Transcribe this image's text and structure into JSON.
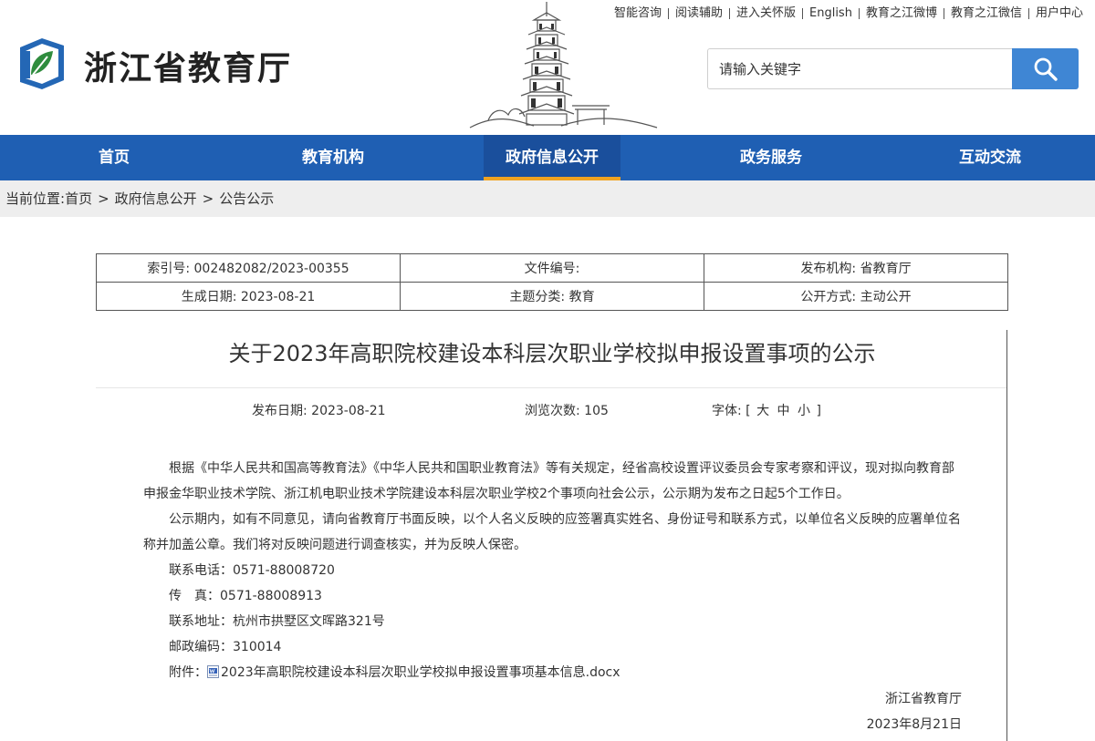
{
  "header": {
    "site_name": "浙江省教育厅",
    "top_links": [
      "智能咨询",
      "阅读辅助",
      "进入关怀版",
      "English",
      "教育之江微博",
      "教育之江微信",
      "用户中心"
    ],
    "search_placeholder": "请输入关键字"
  },
  "nav": {
    "items": [
      "首页",
      "教育机构",
      "政府信息公开",
      "政务服务",
      "互动交流"
    ],
    "active": "政府信息公开"
  },
  "breadcrumb": {
    "prefix": "当前位置:",
    "crumbs": [
      "首页",
      "政府信息公开",
      "公告公示"
    ],
    "separator": ">"
  },
  "meta": {
    "index_no": "索引号: 002482082/2023-00355",
    "doc_no": "文件编号:",
    "publisher": "发布机构: 省教育厅",
    "created": "生成日期: 2023-08-21",
    "category": "主题分类: 教育",
    "open_mode": "公开方式: 主动公开"
  },
  "article": {
    "title": "关于2023年高职院校建设本科层次职业学校拟申报设置事项的公示",
    "publish_date": "发布日期: 2023-08-21",
    "views": "浏览次数: 105",
    "font_label": "字体: [",
    "font_sizes": [
      "大",
      "中",
      "小"
    ],
    "font_close": "]",
    "paragraphs": [
      "根据《中华人民共和国高等教育法》《中华人民共和国职业教育法》等有关规定，经省高校设置评议委员会专家考察和评议，现对拟向教育部申报金华职业技术学院、浙江机电职业技术学院建设本科层次职业学校2个事项向社会公示，公示期为发布之日起5个工作日。",
      "公示期内，如有不同意见，请向省教育厅书面反映，以个人名义反映的应签署真实姓名、身份证号和联系方式，以单位名义反映的应署单位名称并加盖公章。我们将对反映问题进行调查核实，并为反映人保密。"
    ],
    "contacts": [
      "联系电话：0571-88008720",
      "传　真：0571-88008913",
      "联系地址：杭州市拱墅区文晖路321号",
      "邮政编码：310014"
    ],
    "attachment_label": "附件：",
    "attachment_name": "2023年高职院校建设本科层次职业学校拟申报设置事项基本信息.docx",
    "signature_org": "浙江省教育厅",
    "signature_date": "2023年8月21日"
  },
  "colors": {
    "nav_bg": "#1f5fb3",
    "nav_active_underline": "#f0a321",
    "search_button": "#3f86d4",
    "breadcrumb_bg": "#eeeeee"
  }
}
